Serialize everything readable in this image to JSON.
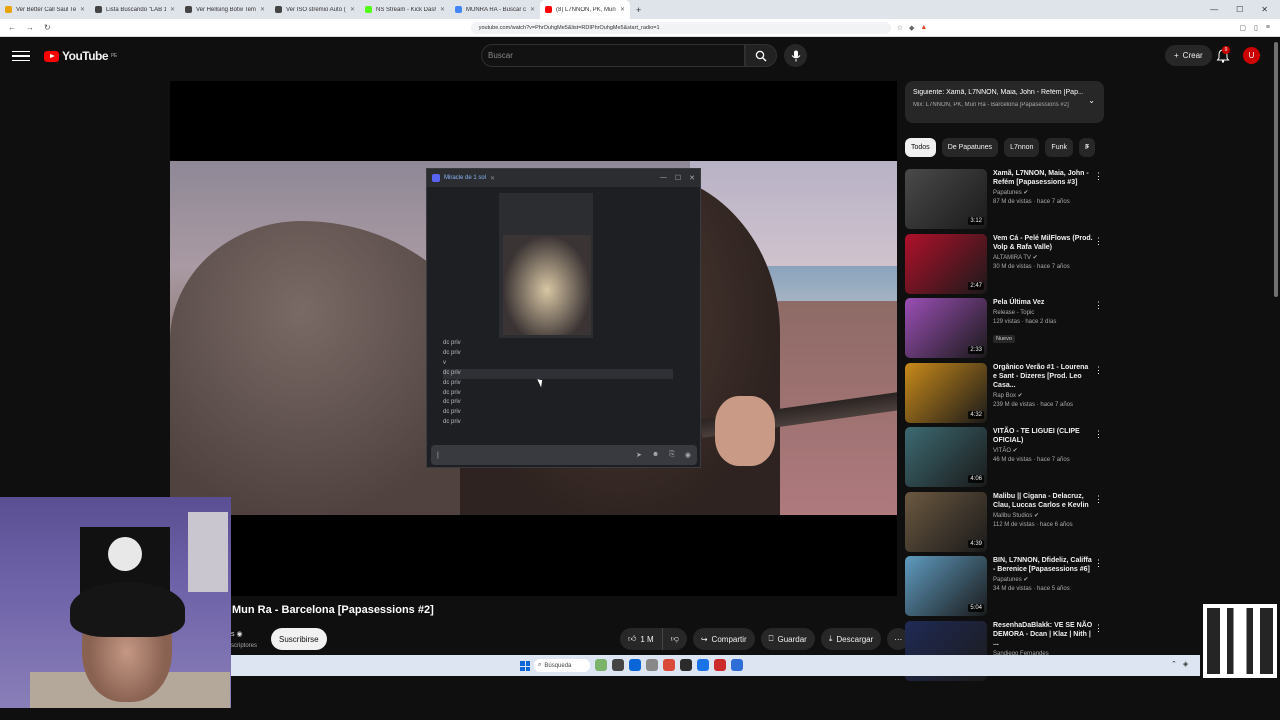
{
  "browser": {
    "tabs": [
      {
        "label": "Ver Better Call Saul Temporada 4 E...",
        "fav": "#e8a400"
      },
      {
        "label": "Lista Buscando \"LAB 100 NAS\"",
        "fav": "#444"
      },
      {
        "label": "Ver Hellsing Botw Temporada 2 Episo...",
        "fav": "#444"
      },
      {
        "label": "Ver ISO stremio Auto (2023) Online...",
        "fav": "#444"
      },
      {
        "label": "NS Stream - Kick Dashboard",
        "fav": "#53fc18"
      },
      {
        "label": "MUNRA RA - Buscar con Google",
        "fav": "#4285f4"
      },
      {
        "label": "(8) L7NNON, PK, Mun Ra - B...",
        "fav": "#ff0000"
      }
    ],
    "url": "youtube.com/watch?v=PhrOuhgMe5&list=RDIPhrOuhgMe5&start_radio=1"
  },
  "header": {
    "logo_text": "YouTube",
    "logo_region": "PE",
    "search_placeholder": "Buscar",
    "create_label": "Crear",
    "notif_count": "9",
    "avatar_letter": "U"
  },
  "discord": {
    "window_title": "Miracle de 1 sol",
    "messages": [
      "dc priv",
      "dc priv",
      "v",
      "dc priv",
      "dc priv",
      "dc priv",
      "dc priv",
      "dc priv",
      "dc priv"
    ],
    "highlighted_index": 3
  },
  "video": {
    "title": "Mun Ra - Barcelona [Papasessions #2]",
    "channel_fragment": "s",
    "subs_fragment": "scriptores",
    "subscribe_label": "Suscribirse",
    "like_count": "1 M",
    "share_label": "Compartir",
    "save_label": "Guardar",
    "download_label": "Descargar"
  },
  "next_up": {
    "title": "Siguiente: Xamã, L7NNON, Maia, John - Refém [Pap...",
    "sub": "Mix: L7NNON, PK, Mun Ra - Barcelona [Papasessions #2]"
  },
  "chips": [
    {
      "label": "Todos",
      "active": true
    },
    {
      "label": "De Papatunes",
      "active": false
    },
    {
      "label": "L7nnon",
      "active": false
    },
    {
      "label": "Funk",
      "active": false
    },
    {
      "label": "F",
      "active": false
    }
  ],
  "recommendations": [
    {
      "title": "Xamã, L7NNON, Maia, John - Refém [Papasessions #3]",
      "channel": "Papatunes",
      "verified": true,
      "meta": "87 M de vistas · hace 7 años",
      "duration": "3:12",
      "color": "#4a4a4a"
    },
    {
      "title": "Vem Cá - Pelé MilFlows (Prod. Volp & Rafa Valle)",
      "channel": "ALTAMIRA TV",
      "verified": true,
      "meta": "30 M de vistas · hace 7 años",
      "duration": "2:47",
      "color": "#b0102a"
    },
    {
      "title": "Pela Última Vez",
      "channel": "Release - Topic",
      "verified": false,
      "meta": "129 vistas · hace 2 días",
      "badge": "Nuevo",
      "duration": "2:33",
      "color": "#9b4fb5"
    },
    {
      "title": "Orgânico Verão #1 - Lourena e Sant - Dizeres [Prod. Leo Casa...",
      "channel": "Rap Box",
      "verified": true,
      "meta": "239 M de vistas · hace 7 años",
      "duration": "4:32",
      "color": "#c98a1a"
    },
    {
      "title": "VITÃO - TE LIGUEI (CLIPE OFICIAL)",
      "channel": "VITÃO",
      "verified": true,
      "meta": "46 M de vistas · hace 7 años",
      "duration": "4:06",
      "color": "#3c6a72"
    },
    {
      "title": "Malibu || Cigana - Delacruz, Clau, Luccas Carlos e Kevlin",
      "channel": "Malibu Studios",
      "verified": true,
      "meta": "112 M de vistas · hace 6 años",
      "duration": "4:39",
      "color": "#6b5840"
    },
    {
      "title": "BIN, L7NNON, Dfideliz, Califfa - Berenice [Papasessions #6]",
      "channel": "Papatunes",
      "verified": true,
      "meta": "34 M de vistas · hace 5 años",
      "duration": "5:04",
      "color": "#5f9bc0"
    },
    {
      "title": "ResenhaDaBlakk: VE SE NÃO DEMORA - Dcan | Klaz | Nith | ...",
      "channel": "Sandiego Fernandes",
      "verified": false,
      "meta": "",
      "duration": "",
      "color": "#202a55"
    }
  ],
  "taskbar": {
    "search_label": "Búsqueda",
    "apps": [
      "#7bb36b",
      "#444",
      "#0a66d8",
      "#888",
      "#d94a3a",
      "#2b2b2b",
      "#1a73e8",
      "#cc2a2a",
      "#2f6ed8"
    ]
  }
}
